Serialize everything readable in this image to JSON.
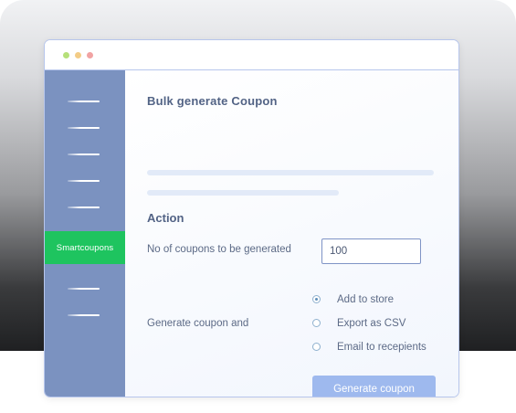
{
  "window": {
    "controls": [
      "green-dot",
      "yellow-dot",
      "red-dot"
    ]
  },
  "sidebar": {
    "active_item_label": "Smartcoupons",
    "accent_color": "#1ec45f",
    "background_color": "#7b92c0"
  },
  "main": {
    "title": "Bulk generate Coupon",
    "section_title": "Action",
    "coupons_label": "No of coupons to be generated",
    "coupons_value": "100",
    "generate_label": "Generate coupon and",
    "options": [
      {
        "label": "Add to store",
        "selected": true
      },
      {
        "label": "Export as CSV",
        "selected": false
      },
      {
        "label": "Email to recepients",
        "selected": false
      }
    ],
    "generate_button_label": "Generate coupon"
  }
}
